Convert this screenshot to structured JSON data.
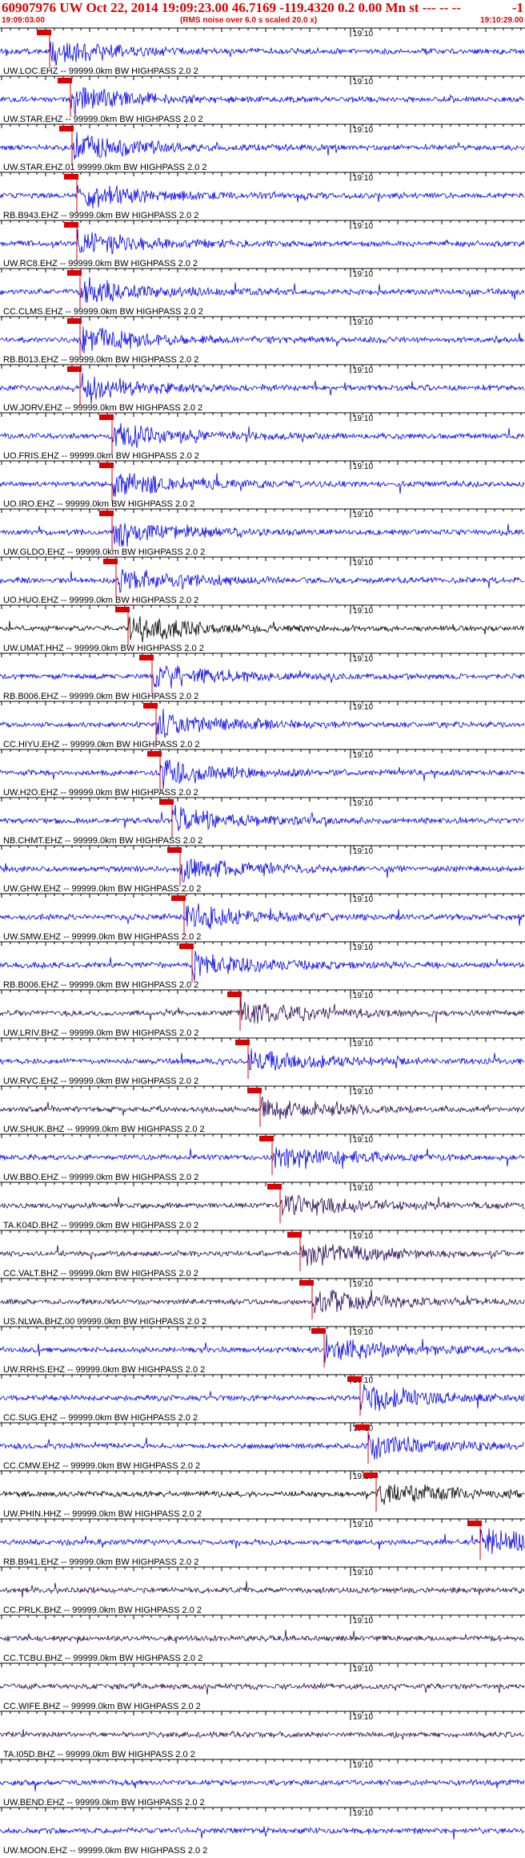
{
  "header": {
    "title": "60907976 UW Oct 22, 2014 19:09:23.00   46.7169 -119.4320  0.2 0.00 Mn st --- -- --",
    "right_flag": "-1",
    "start_time": "19:09:03.00",
    "rms_note": "(RMS noise over 6.0 s scaled 20.0 x)",
    "end_time": "19:10:29.00"
  },
  "colors": {
    "trace_blue": "#0000ee",
    "trace_black": "#000000",
    "trace_purple": "#2a0a55",
    "pick_red": "#dd0000",
    "axis": "#000000"
  },
  "time_label": "19:10",
  "traces": [
    {
      "label": "UW.LOC.EHZ -- 99999.0km BW  HIGHPASS  2.0  2",
      "color": "blue"
    },
    {
      "label": "UW.STAR.EHZ -- 99999.0km BW  HIGHPASS  2.0  2",
      "color": "blue"
    },
    {
      "label": "UW.STAR.EHZ.01 99999.0km BW  HIGHPASS  2.0  2",
      "color": "blue"
    },
    {
      "label": "RB.B943.EHZ -- 99999.0km BW  HIGHPASS  2.0  2",
      "color": "blue"
    },
    {
      "label": "UW.RC8.EHZ -- 99999.0km BW  HIGHPASS  2.0  2",
      "color": "blue"
    },
    {
      "label": "CC.CLMS.EHZ -- 99999.0km BW  HIGHPASS  2.0  2",
      "color": "blue"
    },
    {
      "label": "RB.B013.EHZ -- 99999.0km BW  HIGHPASS  2.0  2",
      "color": "blue"
    },
    {
      "label": "UW.JORV.EHZ -- 99999.0km BW  HIGHPASS  2.0  2",
      "color": "blue"
    },
    {
      "label": "UO.FRIS.EHZ -- 99999.0km BW  HIGHPASS  2.0  2",
      "color": "blue"
    },
    {
      "label": "UO.IRO.EHZ -- 99999.0km BW  HIGHPASS  2.0  2",
      "color": "blue"
    },
    {
      "label": "UW.GLDO.EHZ -- 99999.0km BW  HIGHPASS  2.0  2",
      "color": "blue"
    },
    {
      "label": "UO.HUO.EHZ -- 99999.0km BW  HIGHPASS  2.0  2",
      "color": "blue"
    },
    {
      "label": "UW.UMAT.HHZ -- 99999.0km BW  HIGHPASS  2.0  2",
      "color": "black"
    },
    {
      "label": "RB.B006.EHZ -- 99999.0km BW  HIGHPASS  2.0  2",
      "color": "blue"
    },
    {
      "label": "CC.HIYU.EHZ -- 99999.0km BW  HIGHPASS  2.0  2",
      "color": "blue"
    },
    {
      "label": "UW.H2O.EHZ -- 99999.0km BW  HIGHPASS  2.0  2",
      "color": "blue"
    },
    {
      "label": "NB.CHMT.EHZ -- 99999.0km BW  HIGHPASS  2.0  2",
      "color": "blue"
    },
    {
      "label": "UW.GHW.EHZ -- 99999.0km BW  HIGHPASS  2.0  2",
      "color": "blue"
    },
    {
      "label": "UW.SMW.EHZ -- 99999.0km BW  HIGHPASS  2.0  2",
      "color": "blue"
    },
    {
      "label": "RB.B006.EHZ -- 99999.0km BW  HIGHPASS  2.0  2",
      "color": "blue"
    },
    {
      "label": "UW.LRIV.BHZ -- 99999.0km BW  HIGHPASS  2.0  2",
      "color": "purple"
    },
    {
      "label": "UW.RVC.EHZ -- 99999.0km BW  HIGHPASS  2.0  2",
      "color": "blue"
    },
    {
      "label": "UW.SHUK.BHZ -- 99999.0km BW  HIGHPASS  2.0  2",
      "color": "purple"
    },
    {
      "label": "UW.BBO.EHZ -- 99999.0km BW  HIGHPASS  2.0  2",
      "color": "blue"
    },
    {
      "label": "TA.K04D.BHZ -- 99999.0km BW  HIGHPASS  2.0  2",
      "color": "purple"
    },
    {
      "label": "CC.VALT.BHZ -- 99999.0km BW  HIGHPASS  2.0  2",
      "color": "purple"
    },
    {
      "label": "US.NLWA.BHZ.00 99999.0km BW  HIGHPASS  2.0  2",
      "color": "purple"
    },
    {
      "label": "UW.RRHS.EHZ -- 99999.0km BW  HIGHPASS  2.0  2",
      "color": "blue"
    },
    {
      "label": "CC.SUG.EHZ -- 99999.0km BW  HIGHPASS  2.0  2",
      "color": "blue"
    },
    {
      "label": "CC.CMW.EHZ -- 99999.0km BW  HIGHPASS  2.0  2",
      "color": "blue"
    },
    {
      "label": "UW.PHIN.HHZ -- 99999.0km BW  HIGHPASS  2.0  2",
      "color": "black"
    },
    {
      "label": "RB.B941.EHZ -- 99999.0km BW  HIGHPASS  2.0  2",
      "color": "blue"
    },
    {
      "label": "CC.PRLK.BHZ -- 99999.0km BW  HIGHPASS  2.0  2",
      "color": "purple"
    },
    {
      "label": "CC.TCBU.BHZ -- 99999.0km BW  HIGHPASS  2.0  2",
      "color": "purple"
    },
    {
      "label": "CC.WIFE.BHZ -- 99999.0km BW  HIGHPASS  2.0  2",
      "color": "purple"
    },
    {
      "label": "TA.I05D.BHZ -- 99999.0km BW  HIGHPASS  2.0  2",
      "color": "purple"
    },
    {
      "label": "UW.BEND.EHZ -- 99999.0km BW  HIGHPASS  2.0  2",
      "color": "blue"
    },
    {
      "label": "UW.MOON.EHZ -- 99999.0km BW  HIGHPASS  2.0  2",
      "color": "blue"
    }
  ]
}
